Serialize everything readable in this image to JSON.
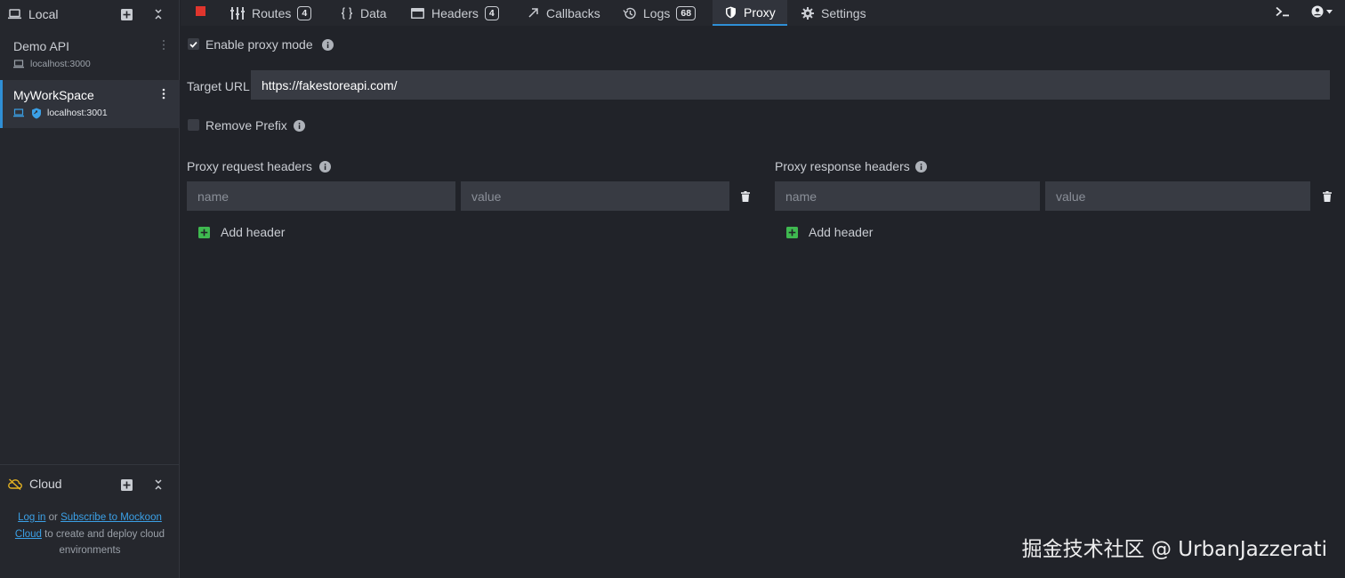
{
  "sidebar": {
    "local_title": "Local",
    "environments": [
      {
        "name": "Demo API",
        "host": "localhost:3000"
      },
      {
        "name": "MyWorkSpace",
        "host": "localhost:3001"
      }
    ],
    "cloud": {
      "title": "Cloud",
      "login_link": "Log in",
      "or_text": " or ",
      "subscribe_link_1": "Subscribe to Mockoon",
      "subscribe_link_2": "Cloud",
      "rest_text": " to create and deploy cloud environments"
    }
  },
  "nav": {
    "tabs": [
      {
        "label": "Routes",
        "badge": "4",
        "icon": "routes-icon"
      },
      {
        "label": "Data",
        "icon": "braces-icon"
      },
      {
        "label": "Headers",
        "badge": "4",
        "icon": "headers-icon"
      },
      {
        "label": "Callbacks",
        "icon": "arrow-icon"
      },
      {
        "label": "Logs",
        "badge": "68",
        "icon": "history-icon"
      },
      {
        "label": "Proxy",
        "icon": "shield-icon",
        "active": true
      },
      {
        "label": "Settings",
        "icon": "gear-icon"
      }
    ]
  },
  "proxy": {
    "enable_label": "Enable proxy mode",
    "enable_checked": true,
    "target_url_label": "Target URL",
    "target_url_value": "https://fakestoreapi.com/",
    "remove_prefix_label": "Remove Prefix",
    "remove_prefix_checked": false,
    "request_headers": {
      "title": "Proxy request headers",
      "name_placeholder": "name",
      "value_placeholder": "value",
      "add_label": "Add header"
    },
    "response_headers": {
      "title": "Proxy response headers",
      "name_placeholder": "name",
      "value_placeholder": "value",
      "add_label": "Add header"
    }
  },
  "watermark": "掘金技术社区 @ UrbanJazzerati",
  "colors": {
    "accent": "#2f8fd6",
    "stop": "#e0352d",
    "add": "#3fb950",
    "cloud_icon": "#e6b422"
  }
}
